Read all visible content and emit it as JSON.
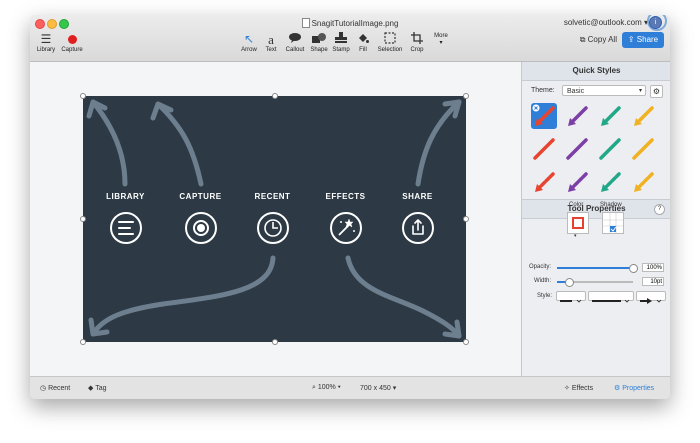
{
  "window": {
    "title": "SnagitTutorialImage.png",
    "account": "solvetic@outlook.com"
  },
  "toolbar": {
    "library_label": "Library",
    "capture_label": "Capture",
    "tools": [
      {
        "label": "Arrow",
        "icon": "arrow-icon"
      },
      {
        "label": "Text",
        "icon": "text-icon"
      },
      {
        "label": "Callout",
        "icon": "callout-icon"
      },
      {
        "label": "Shape",
        "icon": "shape-icon"
      },
      {
        "label": "Stamp",
        "icon": "stamp-icon"
      },
      {
        "label": "Fill",
        "icon": "fill-icon"
      },
      {
        "label": "Selection",
        "icon": "selection-icon"
      },
      {
        "label": "Crop",
        "icon": "crop-icon"
      }
    ],
    "more_label": "More",
    "copy_all_label": "Copy All",
    "share_label": "Share"
  },
  "canvas": {
    "background": "#2d3a45",
    "items": [
      {
        "label": "LIBRARY",
        "icon": "menu-lines-icon"
      },
      {
        "label": "CAPTURE",
        "icon": "record-icon"
      },
      {
        "label": "RECENT",
        "icon": "clock-icon"
      },
      {
        "label": "EFFECTS",
        "icon": "magic-wand-icon"
      },
      {
        "label": "SHARE",
        "icon": "share-icon"
      }
    ]
  },
  "sidebar": {
    "quick_styles_title": "Quick Styles",
    "theme_label": "Theme:",
    "theme_value": "Basic",
    "tool_properties_title": "Tool Properties",
    "color_label": "Color",
    "shadow_label": "Shadow",
    "opacity_label": "Opacity:",
    "opacity_value": "100%",
    "opacity_level": 1.0,
    "width_label": "Width:",
    "width_value": "10pt",
    "style_label": "Style:",
    "accent": "#2f7fd8"
  },
  "statusbar": {
    "recent_label": "Recent",
    "tag_label": "Tag",
    "zoom": "100%",
    "dimensions": "700 x 450",
    "effects_label": "Effects",
    "properties_label": "Properties"
  }
}
